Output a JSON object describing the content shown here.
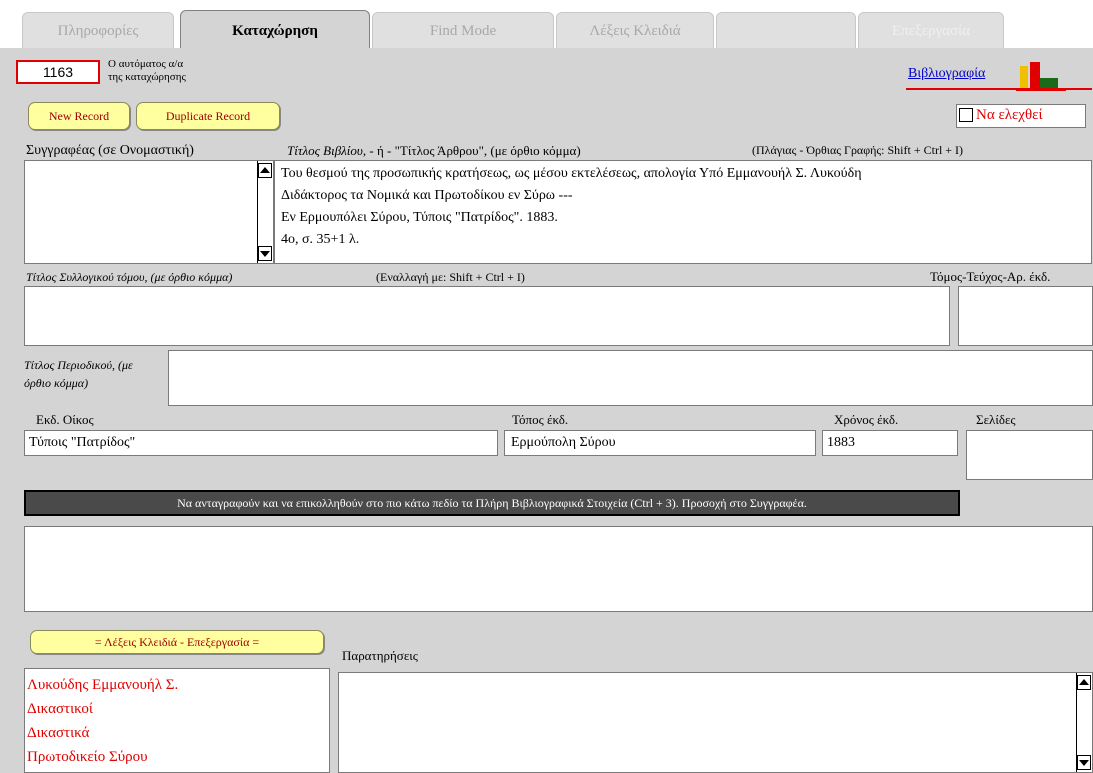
{
  "tabs": [
    "Πληροφορίες",
    "Καταχώρηση",
    "Find Mode",
    "Λέξεις Κλειδιά",
    "",
    "Επεξεργασία"
  ],
  "record": {
    "number": "1163",
    "number_label_line1": "Ο αυτόματος α/α",
    "number_label_line2": "της καταχώρησης"
  },
  "bibliography_link": "Βιβλιογραφία",
  "check_label": "Να ελεχθεί",
  "buttons": {
    "new_record": "New Record",
    "duplicate_record": "Duplicate Record",
    "keywords": "= Λέξεις Κλειδιά - Επεξεργασία ="
  },
  "labels": {
    "author": "Συγγραφέας (σε Ονομαστική)",
    "title_italic": "Τίτλος Βιβλίου",
    "title_rest": ", - ή - \"Τίτλος Άρθρου\", (με όρθιο κόμμα)",
    "title_hint": "(Πλάγιας - Όρθιας Γραφής: Shift + Ctrl + I)",
    "collective": "Τίτλος Συλλογικού τόμου, (με όρθιο κόμμα)",
    "collective_hint": "(Εναλλαγή με: Shift + Ctrl + I)",
    "volume": "Τόμος-Τεύχος-Αρ. έκδ.",
    "journal": "Τίτλος Περιοδικού, (με όρθιο κόμμα)",
    "publisher": "Εκδ. Οίκος",
    "place": "Τόπος έκδ.",
    "year": "Χρόνος έκδ.",
    "pages": "Σελίδες",
    "notice": "Να ανταγραφούν και να επικολληθούν στο πιο κάτω πεδίο τα Πλήρη Βιβλιογραφικά Στοιχεία (Ctrl + 3). Προσοχή στο Συγγραφέα.",
    "remarks": "Παρατηρήσεις"
  },
  "values": {
    "title_lines": [
      "Του θεσμού της προσωπικής κρατήσεως, ως μέσου εκτελέσεως, απολογία Υπό Εμμανουήλ Σ. Λυκούδη",
      "Διδάκτορος τα Νομικά και Πρωτοδίκου εν Σύρω ---",
      "Εν Ερμουπόλει Σύρου, Τύποις \"Πατρίδος\". 1883.",
      "4ο, σ. 35+1 λ."
    ],
    "publisher": "Τύποις \"Πατρίδος\"",
    "place": "Ερμούπολη Σύρου",
    "year": "1883",
    "keywords": [
      "Λυκούδης Εμμανουήλ Σ.",
      "Δικαστικοί",
      "Δικαστικά",
      "Πρωτοδικείο Σύρου"
    ]
  },
  "colors": {
    "accent_red": "#e00000",
    "button_yellow": "#ffffa0",
    "notice_bar": "#4a4a4a",
    "link_blue": "#0000cc"
  }
}
